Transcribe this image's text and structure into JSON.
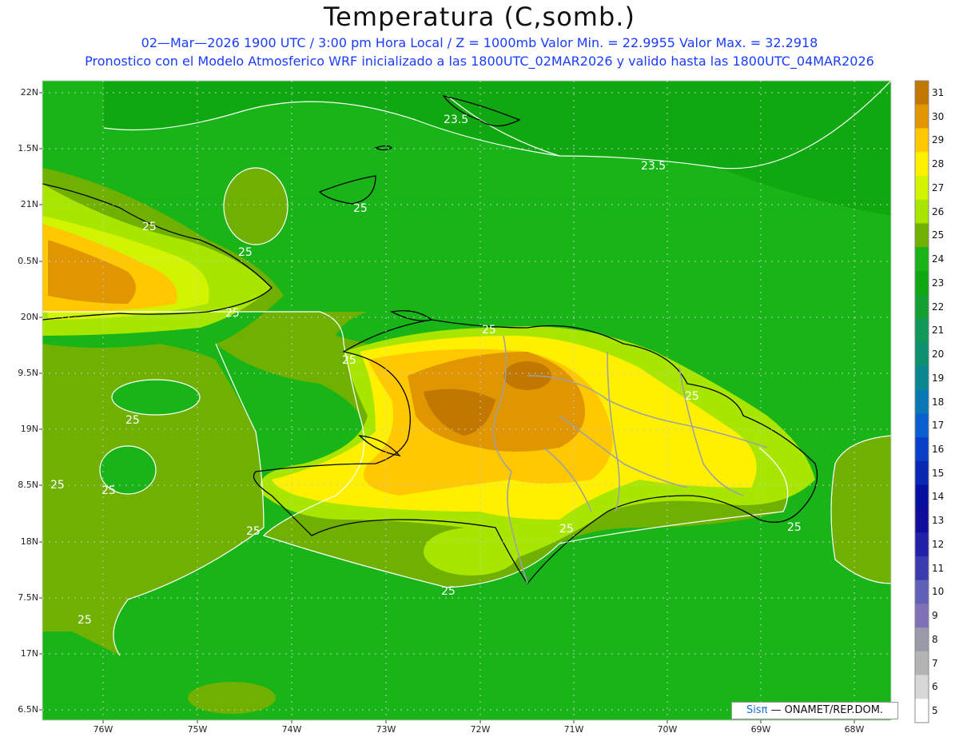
{
  "title": "Temperatura (C,somb.)",
  "subtitle_line1": "02—Mar—2026  1900 UTC / 3:00 pm Hora Local / Z = 1000mb    Valor Min. = 22.9955  Valor Max. = 32.2918",
  "subtitle_line2": "Pronostico con el Modelo Atmosferico WRF inicializado a las 1800UTC_02MAR2026 y valido hasta las  1800UTC_04MAR2026",
  "latitude_ticks": [
    "22N",
    "1.5N",
    "21N",
    "0.5N",
    "20N",
    "9.5N",
    "19N",
    "8.5N",
    "18N",
    "7.5N",
    "17N",
    "6.5N"
  ],
  "longitude_ticks": [
    "76W",
    "75W",
    "74W",
    "73W",
    "72W",
    "71W",
    "70W",
    "69W",
    "68W"
  ],
  "contour_labels": [
    "23.5",
    "23.5",
    "25",
    "25",
    "25",
    "25",
    "25",
    "25",
    "25",
    "25",
    "25",
    "25",
    "25",
    "25",
    "25",
    "25",
    "25"
  ],
  "credit": {
    "brand": "Sisπ",
    "text": " — ONAMET/REP.DOM."
  },
  "colorbar": {
    "labels": [
      "31",
      "30",
      "29",
      "28",
      "27",
      "26",
      "25",
      "24",
      "23",
      "22",
      "21",
      "20",
      "19",
      "18",
      "17",
      "16",
      "15",
      "14",
      "13",
      "12",
      "11",
      "10",
      "9",
      "8",
      "7",
      "6",
      "5"
    ],
    "colors": [
      "#c07800",
      "#e09600",
      "#ffc800",
      "#fff000",
      "#d2f400",
      "#a8e600",
      "#70b000",
      "#18b418",
      "#10a810",
      "#14a030",
      "#109858",
      "#0c9070",
      "#0a8690",
      "#0878b4",
      "#0a5ed0",
      "#083ec8",
      "#0828b4",
      "#0610a0",
      "#100c9c",
      "#2020a8",
      "#3a3ab0",
      "#6060b8",
      "#8070b8",
      "#9a9aa8",
      "#b4b4b4",
      "#d8d8d8",
      "#ffffff"
    ]
  },
  "field_colors": {
    "t23": "#10a810",
    "t24": "#18b418",
    "t25": "#70b000",
    "t26": "#a8e600",
    "t27": "#d2f400",
    "t28": "#fff000",
    "t29": "#ffc800",
    "t30": "#e09600",
    "t31": "#c07800"
  }
}
